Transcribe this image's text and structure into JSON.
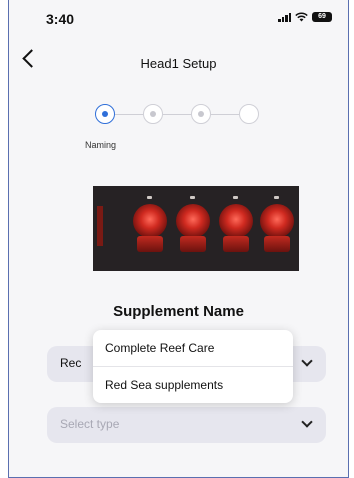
{
  "status_bar": {
    "time": "3:40",
    "battery": "69"
  },
  "header": {
    "title": "Head1 Setup"
  },
  "stepper": {
    "active_label": "Naming",
    "steps": 4,
    "active_index": 0
  },
  "section": {
    "title": "Supplement Name"
  },
  "supplement_select": {
    "value": "Red Sea supplements",
    "visible_text": "Rec"
  },
  "type_select": {
    "placeholder": "Select type"
  },
  "dropdown": {
    "options": [
      "Complete Reef Care",
      "Red Sea supplements"
    ]
  },
  "colors": {
    "accent": "#2f6fd9",
    "pump_red": "#d02a20"
  }
}
